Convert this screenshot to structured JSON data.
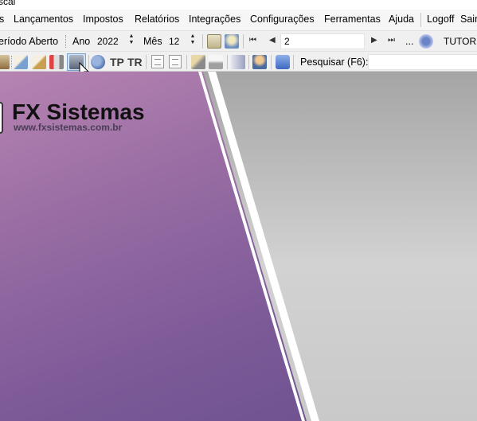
{
  "window": {
    "title_fragment": "scal"
  },
  "menu": {
    "items": [
      "s",
      "Lançamentos",
      "Impostos",
      "Relatórios",
      "Integrações",
      "Configurações",
      "Ferramentas",
      "Ajuda",
      "Logoff",
      "Sair"
    ]
  },
  "toolbar1": {
    "period_label": "eríodo Aberto",
    "ano_label": "Ano",
    "ano_value": "2022",
    "mes_label": "Mês",
    "mes_value": "12",
    "nav_value": "2",
    "nav_ellipsis": "...",
    "company_value": "TUTORIA"
  },
  "toolbar2": {
    "tp_label": "TP",
    "tr_label": "TR",
    "search_label": "Pesquisar (F6):",
    "search_value": ""
  },
  "brand": {
    "name": "FX Sistemas",
    "url": "www.fxsistemas.com.br"
  },
  "colors": {
    "purple_top": "#b784b2",
    "purple_bottom": "#6a4f8e",
    "gray_panel": "#c9c9c9",
    "selected_button": "#cfe3f6"
  }
}
